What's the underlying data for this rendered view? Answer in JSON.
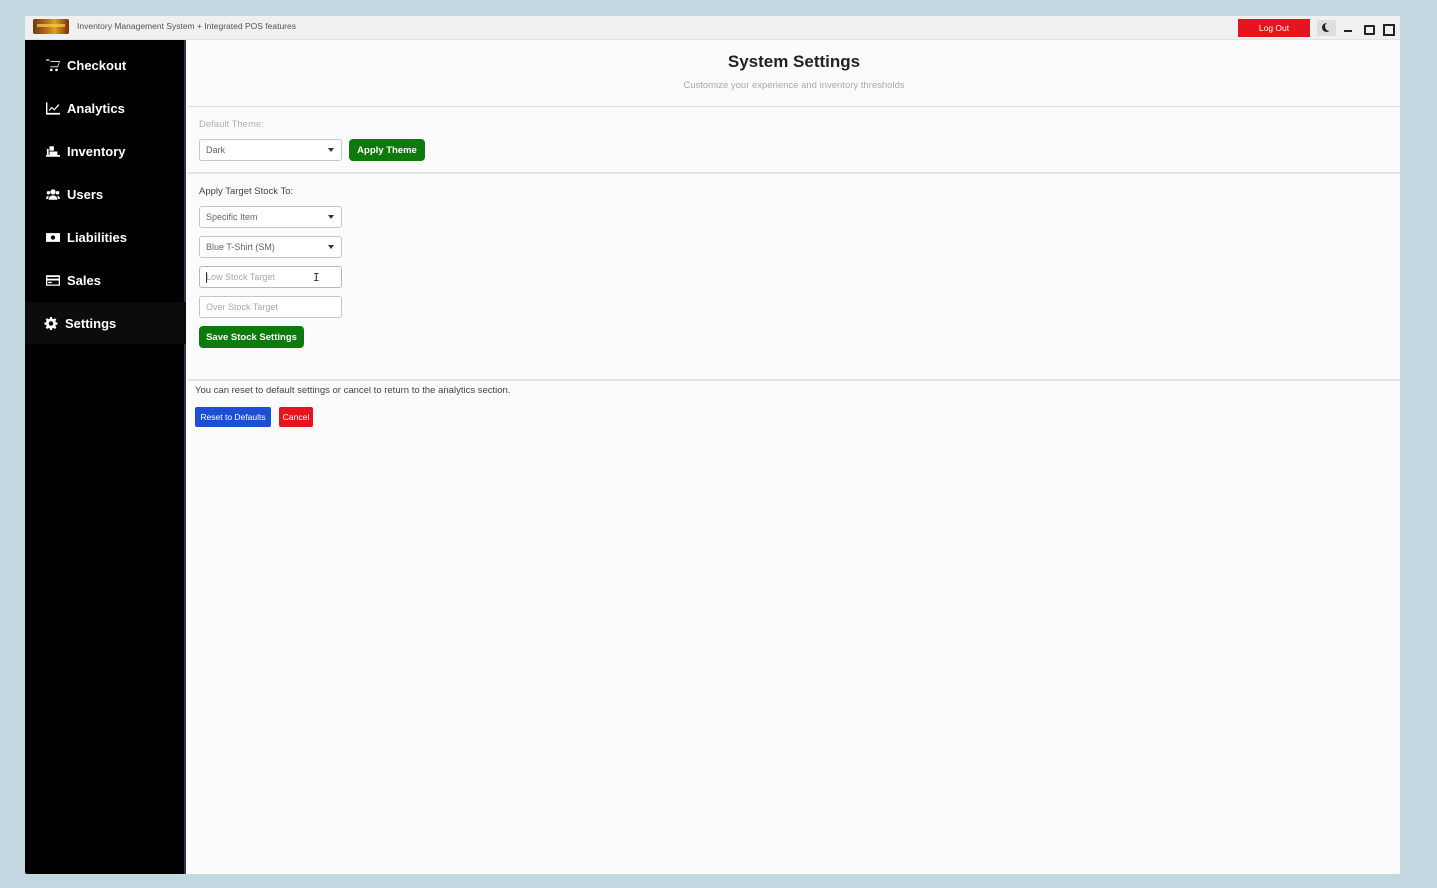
{
  "window": {
    "title": "Inventory Management System + Integrated POS features",
    "logout_label": "Log Out",
    "theme_toggle_icon": "moon-icon"
  },
  "sidebar": {
    "items": [
      {
        "label": "Checkout",
        "icon": "cart-icon"
      },
      {
        "label": "Analytics",
        "icon": "chart-line-icon"
      },
      {
        "label": "Inventory",
        "icon": "dolly-icon"
      },
      {
        "label": "Users",
        "icon": "users-icon"
      },
      {
        "label": "Liabilities",
        "icon": "money-bill-icon"
      },
      {
        "label": "Sales",
        "icon": "credit-card-icon"
      },
      {
        "label": "Settings",
        "icon": "gear-icon",
        "active": true
      }
    ]
  },
  "main": {
    "title": "System Settings",
    "subtitle": "Customize your experience and inventory thresholds",
    "theme_section": {
      "label": "Default Theme:",
      "selected": "Dark",
      "apply_label": "Apply Theme"
    },
    "stock_section": {
      "label": "Apply Target Stock To:",
      "scope_selected": "Specific Item",
      "item_selected": "Blue T-Shirt (SM)",
      "low_placeholder": "Low Stock Target",
      "over_placeholder": "Over Stock Target",
      "save_label": "Save Stock Settings"
    },
    "footer": {
      "note": "You can reset to default settings or cancel to return to the analytics section.",
      "reset_label": "Reset to Defaults",
      "cancel_label": "Cancel"
    }
  },
  "colors": {
    "sidebar_bg": "#000000",
    "accent_green": "#0e7a0e",
    "danger_red": "#e6141c",
    "primary_blue": "#1a4fd6"
  }
}
